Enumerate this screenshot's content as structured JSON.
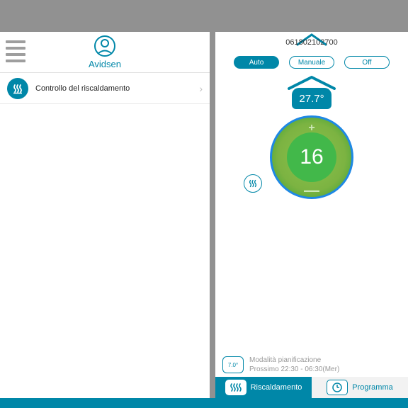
{
  "left": {
    "user_name": "Avidsen",
    "item_label": "Controllo del riscaldamento"
  },
  "right": {
    "device_id": "061802102700",
    "modes": {
      "auto": "Auto",
      "manual": "Manuale",
      "off": "Off"
    },
    "house_temp": "27.7°",
    "setpoint": "16",
    "schedule": {
      "icon_text": "7.0°",
      "line1": "Modalità pianificazione",
      "line2": "Prossimo 22:30 - 06:30(Mer)"
    },
    "tabs": {
      "heating": "Riscaldamento",
      "program": "Programma"
    }
  }
}
